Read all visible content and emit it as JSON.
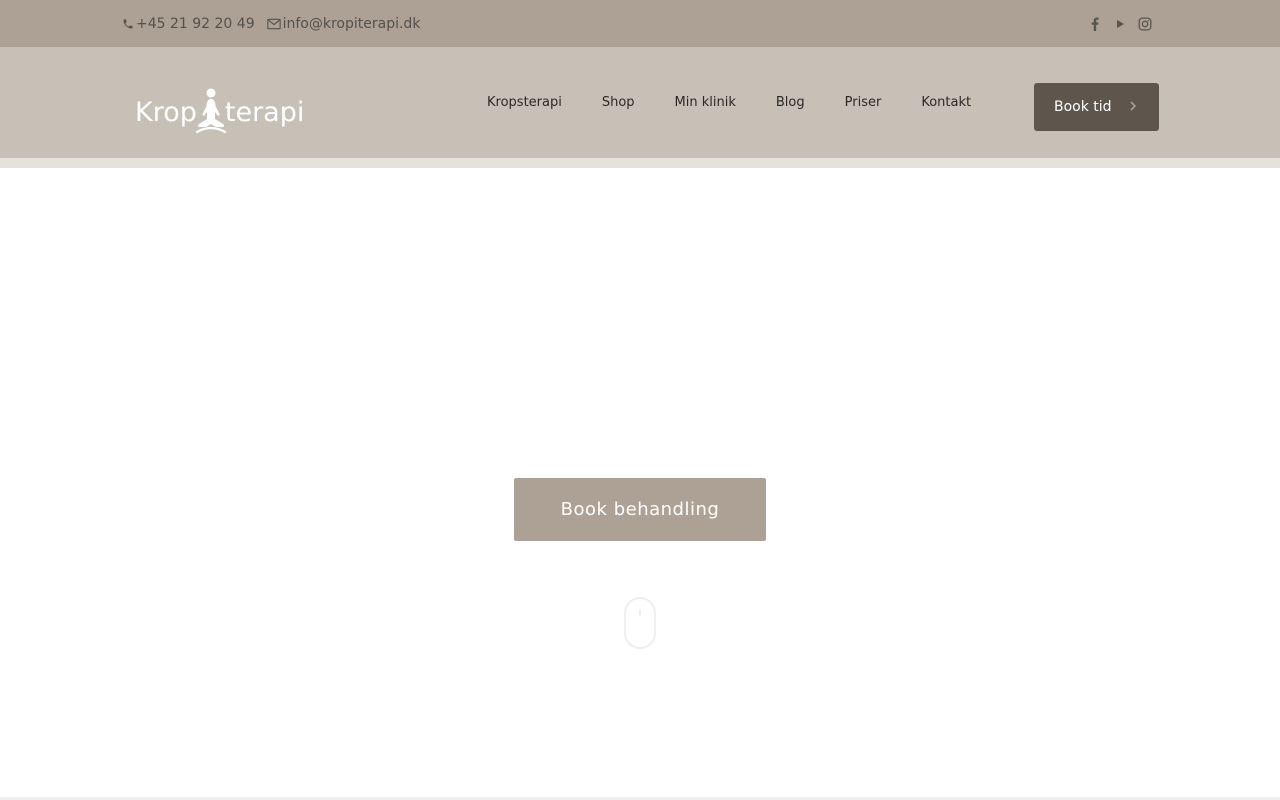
{
  "topbar": {
    "phone": "+45 21 92 20 49",
    "email": "info@kropiterapi.dk",
    "social": [
      {
        "icon": "facebook-icon"
      },
      {
        "icon": "youtube-icon"
      },
      {
        "icon": "instagram-icon"
      }
    ]
  },
  "header": {
    "logo_left": "Krop",
    "logo_right": "terapi",
    "nav": [
      "Kropsterapi",
      "Shop",
      "Min klinik",
      "Blog",
      "Priser",
      "Kontakt"
    ],
    "book_label": "Book tid"
  },
  "hero": {
    "cta_label": "Book behandling"
  },
  "colors": {
    "topbar": "#aca194",
    "header": "#c6c0b6",
    "book_button": "#5e554c",
    "cta": "#aca194"
  }
}
